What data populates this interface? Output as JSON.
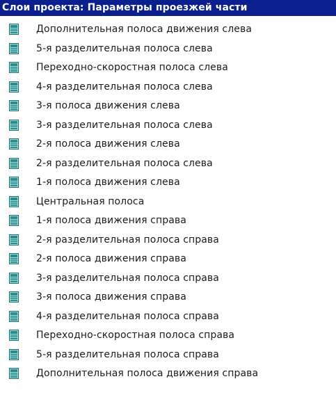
{
  "panel": {
    "title": "Слои проекта: Параметры проезжей части",
    "items": [
      {
        "label": "Дополнительная полоса движения слева"
      },
      {
        "label": "5-я разделительная полоса слева"
      },
      {
        "label": "Переходно-скоростная полоса слева"
      },
      {
        "label": "4-я разделительная полоса слева"
      },
      {
        "label": "3-я полоса движения слева"
      },
      {
        "label": "3-я разделительная полоса слева"
      },
      {
        "label": "2-я полоса движения слева"
      },
      {
        "label": "2-я разделительная полоса слева"
      },
      {
        "label": "1-я полоса движения слева"
      },
      {
        "label": "Центральная полоса"
      },
      {
        "label": "1-я полоса движения справа"
      },
      {
        "label": "2-я разделительная полоса справа"
      },
      {
        "label": "2-я полоса движения справа"
      },
      {
        "label": "3-я разделительная полоса справа"
      },
      {
        "label": "3-я полоса движения справа"
      },
      {
        "label": "4-я разделительная полоса справа"
      },
      {
        "label": "Переходно-скоростная полоса справа"
      },
      {
        "label": "5-я разделительная полоса справа"
      },
      {
        "label": "Дополнительная полоса движения справа"
      }
    ],
    "item_icon": "layer-icon"
  },
  "colors": {
    "header_bg": "#0b1f8f",
    "header_text": "#ffffff",
    "icon_teal": "#2e8b8b",
    "icon_light": "#9fe0e0"
  }
}
